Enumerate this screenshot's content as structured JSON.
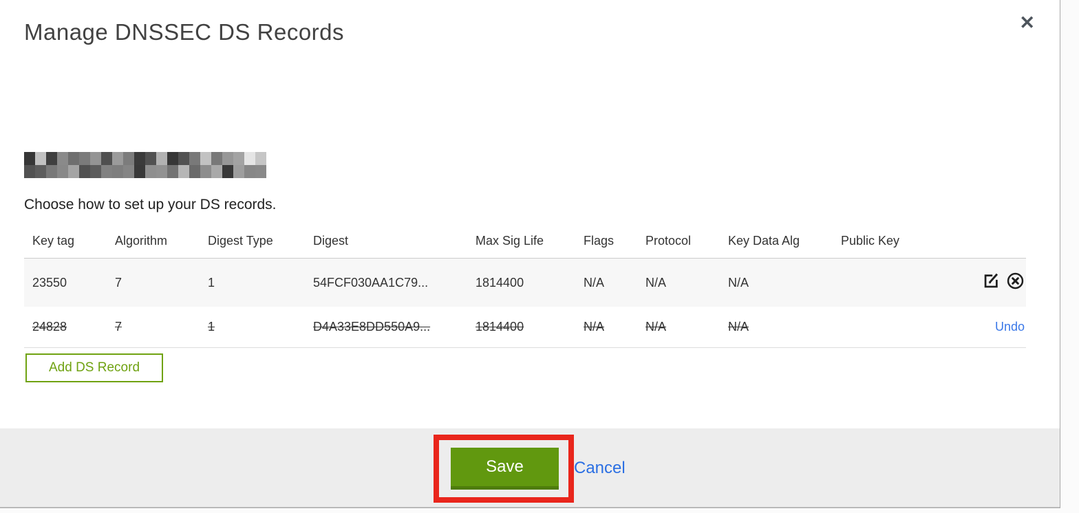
{
  "modal": {
    "title": "Manage DNSSEC DS Records",
    "close_icon": "close-x",
    "domain_redacted": true,
    "subtitle": "Choose how to set up your DS records."
  },
  "table": {
    "columns": [
      "Key tag",
      "Algorithm",
      "Digest Type",
      "Digest",
      "Max Sig Life",
      "Flags",
      "Protocol",
      "Key Data Alg",
      "Public Key"
    ],
    "rows": [
      {
        "key_tag": "23550",
        "algorithm": "7",
        "digest_type": "1",
        "digest": "54FCF030AA1C79...",
        "max_sig_life": "1814400",
        "flags": "N/A",
        "protocol": "N/A",
        "key_data_alg": "N/A",
        "public_key": "",
        "state": "normal",
        "actions": [
          "edit-icon",
          "delete-icon"
        ]
      },
      {
        "key_tag": "24828",
        "algorithm": "7",
        "digest_type": "1",
        "digest": "D4A33E8DD550A9...",
        "max_sig_life": "1814400",
        "flags": "N/A",
        "protocol": "N/A",
        "key_data_alg": "N/A",
        "public_key": "",
        "state": "deleted",
        "action_label": "Undo"
      }
    ]
  },
  "buttons": {
    "add_ds_record": "Add DS Record",
    "save": "Save",
    "cancel": "Cancel"
  },
  "colors": {
    "accent_green": "#61980f",
    "green_outline": "#6fa211",
    "link_blue": "#2b6fe3",
    "annotation_red": "#e9261c",
    "footer_gray": "#ededed",
    "row_stripe": "#f7f7f7"
  }
}
